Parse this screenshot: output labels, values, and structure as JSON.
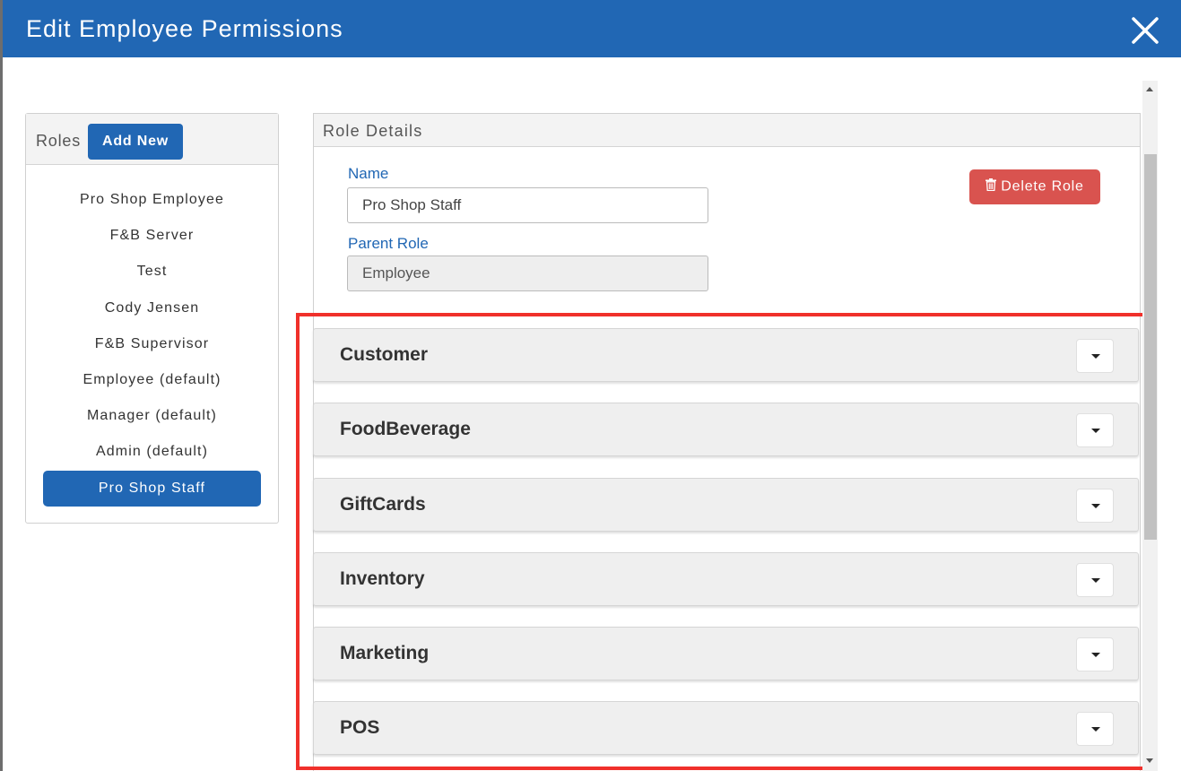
{
  "modal": {
    "title": "Edit Employee Permissions",
    "close_icon": "close-icon",
    "header_color": "#2167b4"
  },
  "roles_panel": {
    "label": "Roles",
    "add_new_label": "Add New",
    "items": [
      {
        "label": "Pro Shop Employee",
        "selected": false
      },
      {
        "label": "F&B Server",
        "selected": false
      },
      {
        "label": "Test",
        "selected": false
      },
      {
        "label": "Cody Jensen",
        "selected": false
      },
      {
        "label": "F&B Supervisor",
        "selected": false
      },
      {
        "label": "Employee (default)",
        "selected": false
      },
      {
        "label": "Manager (default)",
        "selected": false
      },
      {
        "label": "Admin (default)",
        "selected": false
      },
      {
        "label": "Pro Shop Staff",
        "selected": true
      }
    ]
  },
  "role_details": {
    "label": "Role Details",
    "name_label": "Name",
    "name_value": "Pro Shop Staff",
    "parent_role_label": "Parent Role",
    "parent_role_value": "Employee",
    "delete_label": "Delete Role",
    "delete_icon": "trash-icon",
    "delete_color": "#d9534f"
  },
  "sections": [
    {
      "title": "Customer"
    },
    {
      "title": "FoodBeverage"
    },
    {
      "title": "GiftCards"
    },
    {
      "title": "Inventory"
    },
    {
      "title": "Marketing"
    },
    {
      "title": "POS"
    }
  ],
  "highlight_color": "#f0302b"
}
